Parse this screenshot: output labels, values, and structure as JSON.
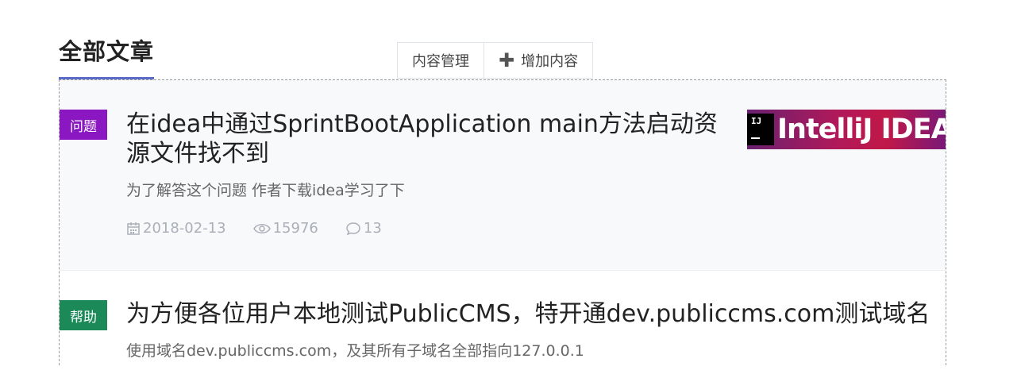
{
  "section": {
    "title": "全部文章"
  },
  "toolbar": {
    "manage_label": "内容管理",
    "add_label": "增加内容"
  },
  "articles": [
    {
      "tag": "问题",
      "tag_color": "#8a17c2",
      "title": "在idea中通过SprintBootApplication main方法启动资源文件找不到",
      "summary": "为了解答这个问题 作者下载idea学习了下",
      "date": "2018-02-13",
      "views": "15976",
      "comments": "13",
      "thumbnail": {
        "mark": "IJ",
        "text": "IntelliJ IDEA"
      }
    },
    {
      "tag": "帮助",
      "tag_color": "#1b8a58",
      "title": "为方便各位用户本地测试PublicCMS，特开通dev.publiccms.com测试域名",
      "summary": "使用域名dev.publiccms.com，及其所有子域名全部指向127.0.0.1"
    }
  ],
  "colors": {
    "accent_underline": "#5b6bc8",
    "meta_text": "#aab0b8"
  },
  "icons": [
    "calendar-icon",
    "eye-icon",
    "comment-icon",
    "plus-icon"
  ]
}
